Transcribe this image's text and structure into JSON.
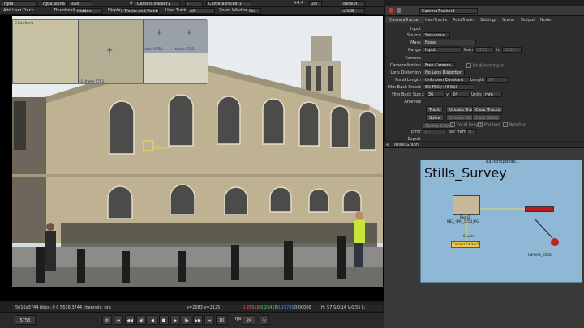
{
  "viewer_toolbar": {
    "channels": "rgba",
    "alpha": "rgba.alpha",
    "colorspace": "RGB",
    "input_a": "A",
    "node_a": "CameraTracker1",
    "mode": "-",
    "node_b": "CameraTracker1",
    "gain": "+4.4",
    "view": "2D",
    "lut": "default",
    "lut2": "sRGB",
    "add_user_track": "Add User Track",
    "thumbnails_label": "Thumbnails",
    "thumbnails_value": "Hidden",
    "display_label": "Display",
    "display_value": "Tracks and Points",
    "user_tracks_label": "User Tracks",
    "user_tracks_value": "All",
    "zoom_window_label": "Zoom Window",
    "zoom_window_value": "On",
    "frame_range": "1"
  },
  "viewer": {
    "zoom_top_label": "Checkerb",
    "zoom_cell_a": "frame 5753",
    "zoom_cell_b": "frame 5753",
    "zoom_bottom_label": "-1, frame 5753",
    "track_label": "4.1 frame"
  },
  "status_bar": {
    "format": "5616x3744 bbox: 0 0 5616 3744 channels: rgb",
    "coords": "x=2083 y=2125",
    "r": "0.25918",
    "g": "0.25418",
    "b": "0.19780",
    "a": "0.00000",
    "hsvl": "H: 57 S:0.14 V:0.55 L: 0.25023"
  },
  "timeline": {
    "frame": "5753",
    "play_count": "10",
    "fps_label": "fps",
    "fps": "24"
  },
  "properties": {
    "node_name": "CameraTracker1",
    "tabs": [
      "CameraTracker",
      "UserTracks",
      "AutoTracks",
      "Settings",
      "Scene",
      "Output",
      "Node"
    ],
    "input_header": "Input",
    "source_label": "Source",
    "source_value": "Sequence",
    "mask_label": "Mask",
    "mask_value": "None",
    "range_label": "Range",
    "range_value": "Input",
    "range_from": "from",
    "range_from_value": "5753",
    "range_to": "to",
    "range_to_value": "5753",
    "camera_header": "Camera",
    "camera_motion_label": "Camera Motion",
    "camera_motion_value": "Free Camera",
    "undistort_label": "Undistort Input",
    "lens_distortion_label": "Lens Distortion",
    "lens_distortion_value": "No Lens Distortion",
    "focal_length_label": "Focal Length",
    "focal_length_value": "Unknown Constant",
    "length_label": "Length",
    "length_value": "50",
    "film_back_preset_label": "Film Back Preset",
    "film_back_preset_value": "5D MKII/+III Still",
    "film_back_size_label": "Film Back Size",
    "film_x_label": "x",
    "film_x_value": "36",
    "film_y_label": "y",
    "film_y_value": "24",
    "units_label": "Units",
    "units_value": "mm",
    "analysis_header": "Analysis",
    "track_button": "Track",
    "update_track_button": "Update Track",
    "clear_tracks_button": "Clear Tracks",
    "solve_button": "Solve",
    "update_solve_button": "Update Solve",
    "clear_solve_button": "Clear Solve",
    "refine_solve_button": "Refine Solve",
    "refine_focal_label": "Focal Length",
    "refine_position_label": "Position",
    "refine_rotation_label": "Rotation",
    "error_label": "Error",
    "error_value": "0",
    "per_frame_label": "per frame",
    "per_frame_value": "0",
    "export_header": "Export"
  },
  "node_graph": {
    "title": "Node Graph",
    "backdrop_label": "BackdropNode1",
    "backdrop_title": "Stills_Survey",
    "read_label": "Read2",
    "read_file": "KB3_-IMG_5753.JPG",
    "source_label": "Source",
    "tracker_label": "CameraTracker1",
    "camera_label": "Camera_Tracks"
  },
  "colors": {
    "accent_red": "#c0392b",
    "backdrop_blue": "#8fb8d6",
    "node_selected": "#f2c84b"
  }
}
